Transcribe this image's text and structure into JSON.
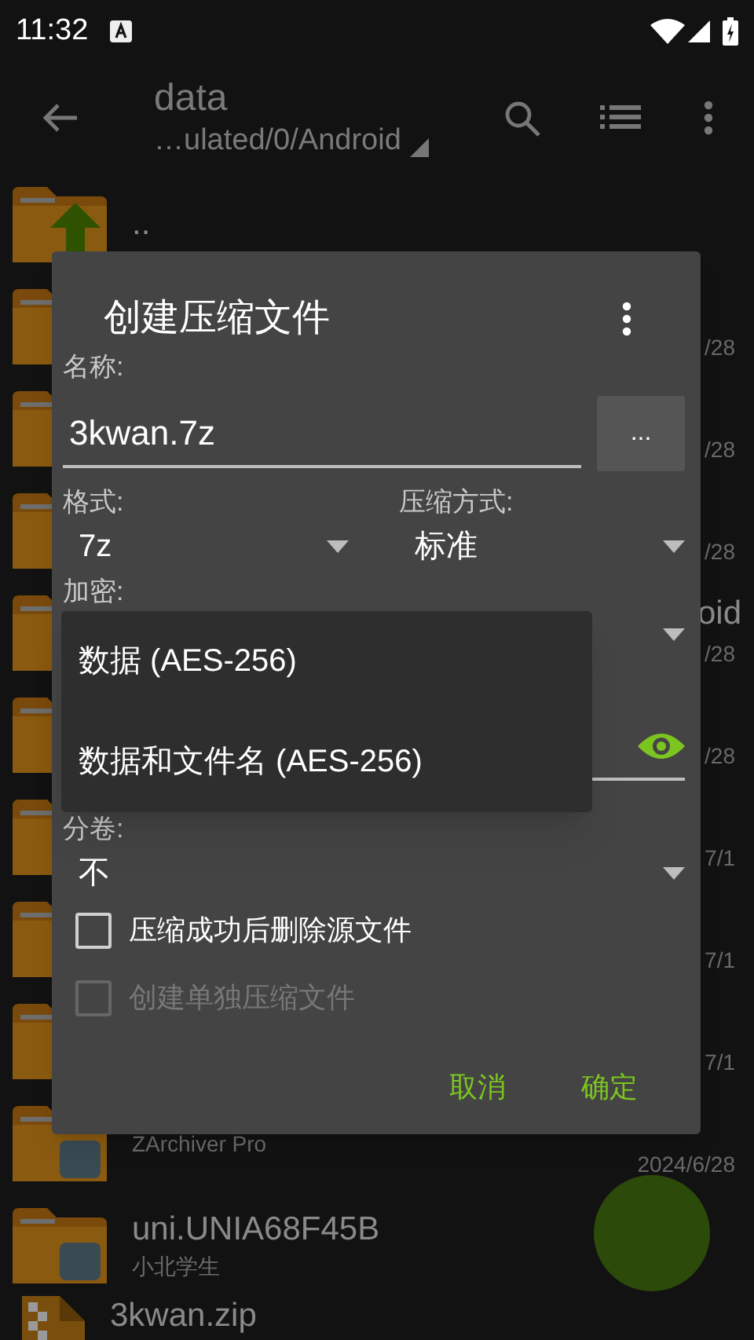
{
  "status_bar": {
    "time": "11:32"
  },
  "toolbar": {
    "title": "data",
    "path": "…ulated/0/Android"
  },
  "files": [
    {
      "kind": "up",
      "name": ".."
    },
    {
      "kind": "folder",
      "date": "/28"
    },
    {
      "kind": "folder",
      "date": "/28"
    },
    {
      "kind": "folder",
      "date": "/28"
    },
    {
      "kind": "folder",
      "name": "oid",
      "date": "/28"
    },
    {
      "kind": "folder",
      "date": "/28"
    },
    {
      "kind": "folder",
      "date": "7/1"
    },
    {
      "kind": "folder",
      "date": "7/1"
    },
    {
      "kind": "folder",
      "date": "7/1"
    },
    {
      "kind": "app",
      "sub": "ZArchiver Pro",
      "date": "2024/6/28"
    },
    {
      "kind": "app",
      "name": "uni.UNIA68F45B",
      "sub": "小北学生"
    },
    {
      "kind": "zip",
      "name": "3kwan.zip"
    }
  ],
  "dialog": {
    "title": "创建压缩文件",
    "name_label": "名称:",
    "name_value": "3kwan.7z",
    "browse_button": "...",
    "format_label": "格式:",
    "format_value": "7z",
    "method_label": "压缩方式:",
    "method_value": "标准",
    "encryption_label": "加密:",
    "split_label": "分卷:",
    "split_value": "不",
    "options": [
      {
        "label": "压缩成功后删除源文件",
        "checked": false,
        "disabled": false
      },
      {
        "label": "创建单独压缩文件",
        "checked": false,
        "disabled": true
      }
    ],
    "buttons": [
      "取消",
      "确定"
    ]
  },
  "encryption_menu": {
    "items": [
      "数据 (AES-256)",
      "数据和文件名 (AES-256)"
    ]
  }
}
